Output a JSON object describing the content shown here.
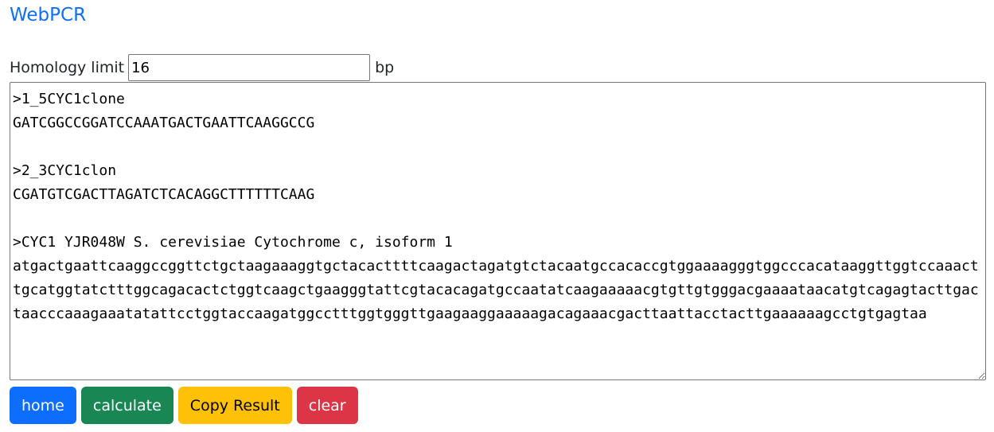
{
  "app": {
    "title": "WebPCR"
  },
  "homology": {
    "label": "Homology limit",
    "value": "16",
    "unit": "bp"
  },
  "sequences": {
    "text": ">1_5CYC1clone\nGATCGGCCGGATCCAAATGACTGAATTCAAGGCCG\n\n>2_3CYC1clon\nCGATGTCGACTTAGATCTCACAGGCTTTTTTCAAG\n\n>CYC1 YJR048W S. cerevisiae Cytochrome c, isoform 1\natgactgaattcaaggccggttctgctaagaaaggtgctacacttttcaagactagatgtctacaatgccacaccgtggaaaagggtggcccacataaggttggtccaaacttgcatggtatctttggcagacactctggtcaagctgaagggtattcgtacacagatgccaatatcaagaaaaacgtgttgtgggacgaaaataacatgtcagagtacttgactaacccaaagaaatatattcctggtaccaagatggcctttggtgggttgaagaaggaaaaagacagaaacgacttaattacctacttgaaaaaagcctgtgagtaa"
  },
  "buttons": {
    "home": "home",
    "calculate": "calculate",
    "copy": "Copy Result",
    "clear": "clear"
  }
}
